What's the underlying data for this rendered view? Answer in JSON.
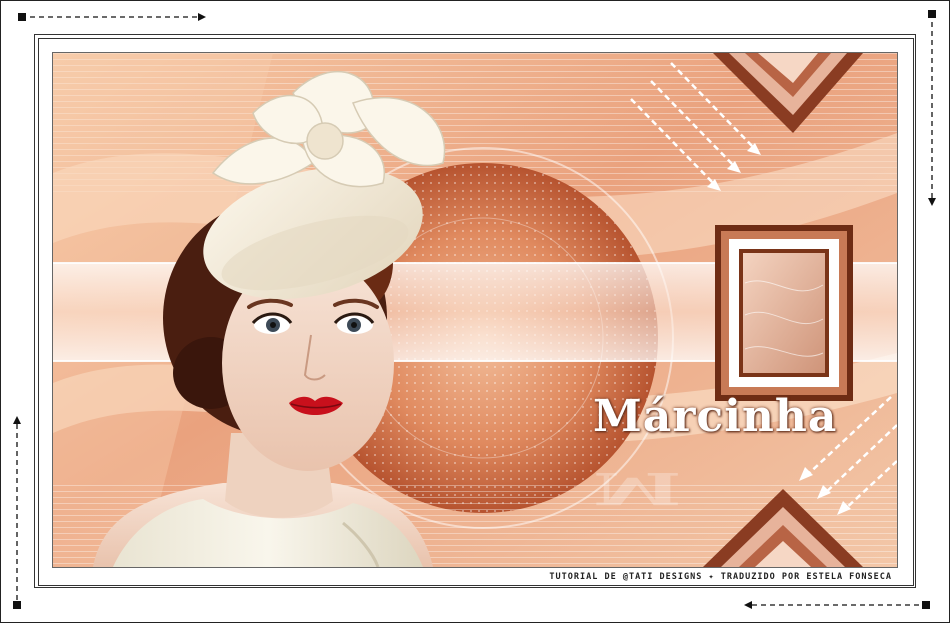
{
  "signature": "Márcinha",
  "credit": "TUTORIAL DE @TATI DESIGNS ✦ TRADUZIDO POR ESTELA FONSECA",
  "colors": {
    "peach": "#f0b592",
    "copper": "#c56a46",
    "dark_copper": "#8a3c22",
    "cream": "#f5efe2",
    "lips": "#c8101c"
  }
}
